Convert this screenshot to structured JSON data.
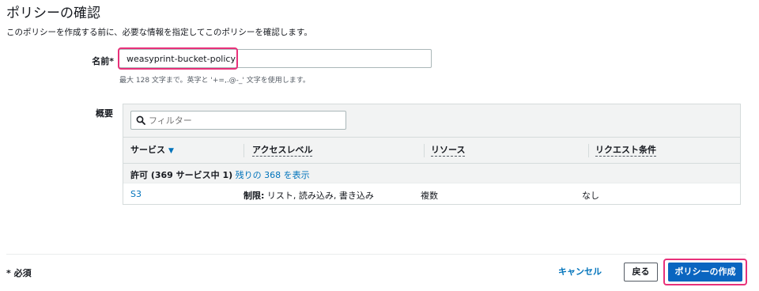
{
  "page": {
    "title": "ポリシーの確認",
    "subtitle": "このポリシーを作成する前に、必要な情報を指定してこのポリシーを確認します。"
  },
  "name_field": {
    "label": "名前*",
    "value": "weasyprint-bucket-policy",
    "hint": "最大 128 文字まで。英字と '+=,.@-_' 文字を使用します。",
    "highlight_color": "#e8317a"
  },
  "summary": {
    "label": "概要",
    "filter": {
      "placeholder": "フィルター",
      "icon": "search-icon"
    },
    "columns": [
      {
        "label": "サービス",
        "sort_icon": "caret-down-icon"
      },
      {
        "label": "アクセスレベル"
      },
      {
        "label": "リソース"
      },
      {
        "label": "リクエスト条件"
      }
    ],
    "group": {
      "prefix": "許可 (369 サービス中 1)",
      "link": "残りの 368 を表示"
    },
    "rows": [
      {
        "service": "S3",
        "access_bold": "制限:",
        "access_rest": " リスト, 読み込み, 書き込み",
        "resource": "複数",
        "condition": "なし"
      }
    ]
  },
  "footer": {
    "required_note": "* 必須",
    "cancel_label": "キャンセル",
    "back_label": "戻る",
    "create_label": "ポリシーの作成"
  },
  "colors": {
    "link": "#0073bb",
    "primary_button": "#0a65c0",
    "highlight": "#e8317a"
  }
}
